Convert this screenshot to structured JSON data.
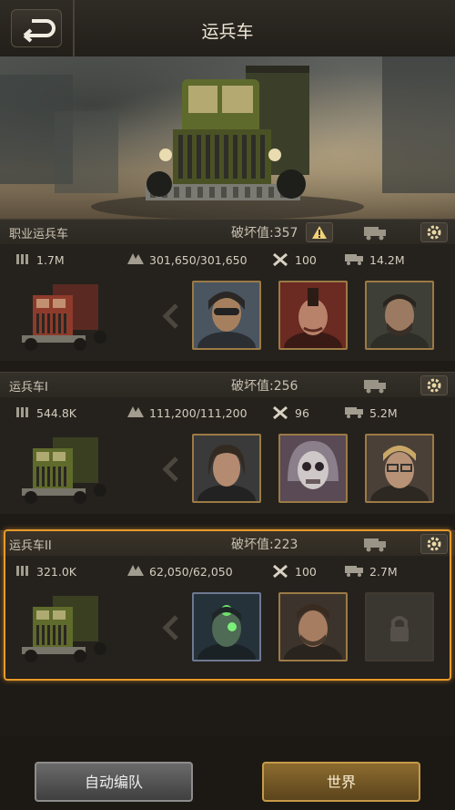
{
  "header": {
    "title": "运兵车",
    "back_icon": "back-arrow-icon"
  },
  "damage_label_prefix": "破坏值:",
  "vehicles": [
    {
      "name": "职业运兵车",
      "damage": "357",
      "warning": true,
      "stats": {
        "ammo": "1.7M",
        "hp": "301,650/301,650",
        "repair": "100",
        "cargo": "14.2M"
      },
      "truck_color": "#8e3b2b",
      "heroes": [
        {
          "name": "hero-goggles-woman",
          "bg": "#4a5560",
          "skin": "#a6805e",
          "hair": "#2a2724"
        },
        {
          "name": "hero-mohawk-man",
          "bg": "#6b2a22",
          "skin": "#b8826a",
          "hair": "#2c1c16"
        },
        {
          "name": "hero-bearded-soldier",
          "bg": "#3e3f36",
          "skin": "#9c7a62",
          "hair": "#2a241e"
        }
      ],
      "selected": false
    },
    {
      "name": "运兵车I",
      "damage": "256",
      "warning": false,
      "stats": {
        "ammo": "544.8K",
        "hp": "111,200/111,200",
        "repair": "96",
        "cargo": "5.2M"
      },
      "truck_color": "#5f6b2b",
      "heroes": [
        {
          "name": "hero-longhair-man",
          "bg": "#3a3a3a",
          "skin": "#b48b70",
          "hair": "#332a22"
        },
        {
          "name": "hero-skull-mask",
          "bg": "#5a4a55",
          "skin": "#cfc8c8",
          "hair": "#8a7f8a"
        },
        {
          "name": "hero-blond-glasses",
          "bg": "#4a4038",
          "skin": "#b89276",
          "hair": "#c9a867"
        }
      ],
      "selected": false
    },
    {
      "name": "运兵车II",
      "damage": "223",
      "warning": false,
      "stats": {
        "ammo": "321.0K",
        "hp": "62,050/62,050",
        "repair": "100",
        "cargo": "2.7M"
      },
      "truck_color": "#5f6b2b",
      "heroes": [
        {
          "name": "hero-cyborg",
          "bg": "#26323a",
          "skin": "#4f6a55",
          "hair": "#1f2628"
        },
        {
          "name": "hero-rugged-man",
          "bg": "#3c342c",
          "skin": "#a77d61",
          "hair": "#3a2b20"
        }
      ],
      "selected": true
    }
  ],
  "buttons": {
    "auto_formation": "自动编队",
    "world": "世界"
  },
  "colors": {
    "accent_orange": "#e89a2a",
    "slot_border": "#9c7a45"
  }
}
